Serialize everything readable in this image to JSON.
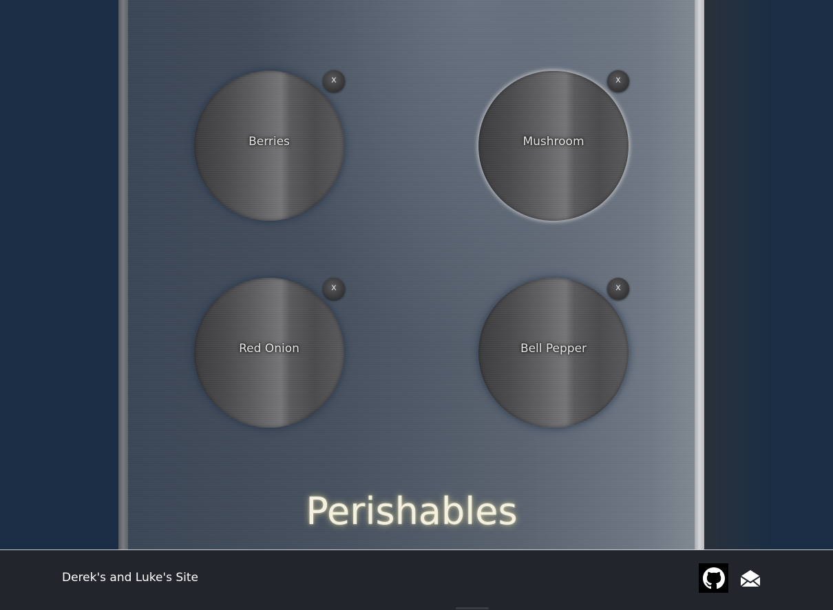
{
  "section": {
    "title": "Perishables",
    "items": [
      {
        "label": "Berries",
        "remove": "x"
      },
      {
        "label": "Mushroom",
        "remove": "x"
      },
      {
        "label": "Red Onion",
        "remove": "x"
      },
      {
        "label": "Bell Pepper",
        "remove": "x"
      }
    ]
  },
  "footer": {
    "site_name": "Derek's and Luke's Site",
    "links": [
      {
        "icon": "github-icon"
      },
      {
        "icon": "mail-icon"
      }
    ]
  },
  "colors": {
    "page_background": "#1a2d45",
    "footer_background": "#22262c",
    "title_glow": "#e6dc96"
  }
}
